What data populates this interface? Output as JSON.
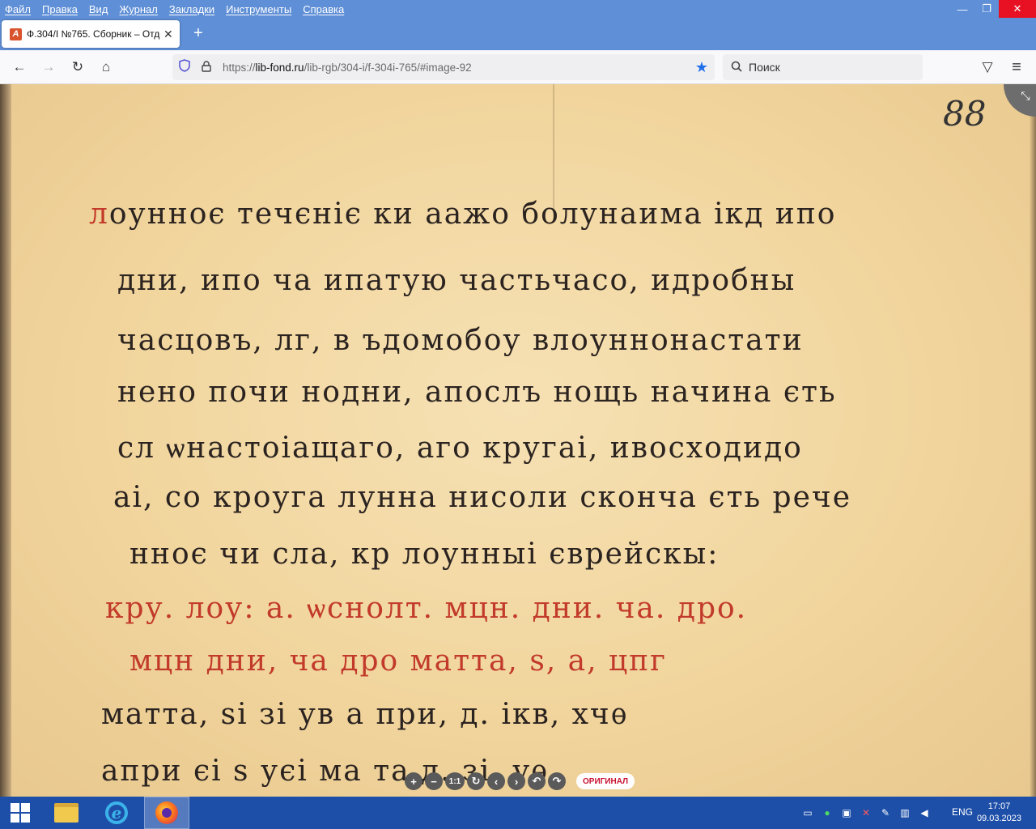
{
  "menu": {
    "items": [
      "Файл",
      "Правка",
      "Вид",
      "Журнал",
      "Закладки",
      "Инструменты",
      "Справка"
    ]
  },
  "window_controls": {
    "minimize": "—",
    "restore": "❐",
    "close": "✕"
  },
  "tab": {
    "favicon_letter": "A",
    "title": "Ф.304/I №765. Сборник – Отде",
    "close": "✕",
    "new_tab": "+"
  },
  "nav": {
    "back": "←",
    "forward": "→",
    "reload": "↻",
    "home": "⌂",
    "url_prefix": "https://",
    "url_host": "lib-fond.ru",
    "url_path": "/lib-rgb/304-i/f-304i-765/#image-92",
    "search_placeholder": "Поиск",
    "pocket": "▽",
    "menu": "≡"
  },
  "viewer": {
    "folio": "88",
    "collapse": "⤡",
    "lines": [
      {
        "text": "лоунноє течєніє",
        "red": "л",
        "rest": "оунноє течєніє ки аажо болунаима ікд ипо"
      },
      {
        "text": "дни, ипо ча ипатую частьчасо, идробны"
      },
      {
        "text": "часцовъ, лг, в ъдомобоу влоуннонастати"
      },
      {
        "text": "нено почи нодни, апослъ нощь начина єть"
      },
      {
        "text": "сл ѡнастоіащаго, аго кругаі, ивосходидо"
      },
      {
        "text": "аі, со кроуга лунна нисоли сконча єть рече"
      },
      {
        "text": "нноє чи сла, кр лоунныі єврейскы:"
      },
      {
        "text": "кру. лоу: а. ѡснолт. мцн. дни. ча. дро."
      },
      {
        "text": "мцн дни, ча дро матта, ѕ, а, цпг"
      },
      {
        "text": "матта, ѕі зі ув а при, д. ікв, хчѳ"
      },
      {
        "text": "апри єі ѕ уєі ма та д. зі. уѳ"
      }
    ],
    "toolbar": {
      "zoom_in": "+",
      "zoom_out": "−",
      "actual_size": "1:1",
      "rotate": "↻",
      "prev": "‹",
      "next": "›",
      "undo": "↶",
      "redo": "↷",
      "original": "ОРИГИНАЛ"
    }
  },
  "taskbar": {
    "lang": "ENG",
    "time": "17:07",
    "date": "09.03.2023"
  }
}
